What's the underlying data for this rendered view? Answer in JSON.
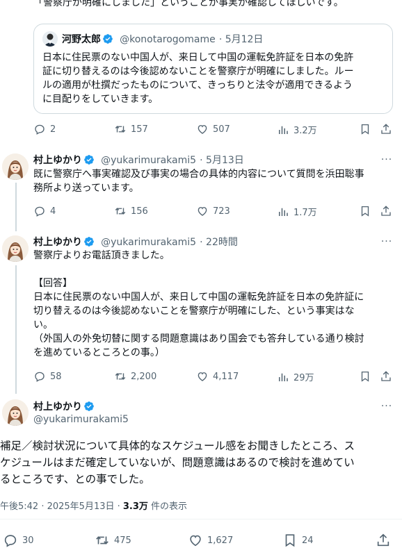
{
  "top_text": "「警察庁が明確にしました」ということが事実か確認してほしいです。",
  "quote": {
    "name": "河野太郎",
    "handle": "@konotarogomame",
    "date": "· 5月12日",
    "text": "日本に住民票のない中国人が、来日して中国の運転免許証を日本の免許\n証に切り替えるのは今後認めないことを警察庁が明確にしました。ルー\nルの適用が杜撰だったものについて、きっちりと法令が適用できるよう\nに目配りをしていきます。"
  },
  "tweet0_actions": {
    "replies": "2",
    "retweets": "157",
    "likes": "507",
    "views": "3.2万"
  },
  "tweet1": {
    "name": "村上ゆかり",
    "handle": "@yukarimurakami5",
    "date": "· 5月13日",
    "text": "既に警察庁へ事実確認及び事実の場合の具体的内容について質問を浜田聡事\n務所より送っています。",
    "replies": "4",
    "retweets": "156",
    "likes": "723",
    "views": "1.7万"
  },
  "tweet2": {
    "name": "村上ゆかり",
    "handle": "@yukarimurakami5",
    "date": "· 22時間",
    "text": "警察庁よりお電話頂きました。\n\n【回答】\n日本に住民票のない中国人が、来日して中国の運転免許証を日本の免許証に\n切り替えるのは今後認めないことを警察庁が明確にした、という事実はな\nい。\n（外国人の外免切替に関する問題意識はあり国会でも答弁している通り検討\nを進めているところとの事。）",
    "replies": "58",
    "retweets": "2,200",
    "likes": "4,117",
    "views": "29万"
  },
  "main": {
    "name": "村上ゆかり",
    "handle": "@yukarimurakami5",
    "text": "補足／検討状況について具体的なスケジュール感をお聞きしたところ、ス\nケジュールはまだ確定していないが、問題意識はあるので検討を進めてい\nるところです、との事でした。",
    "timestamp": "午後5:42 · 2025年5月13日 · ",
    "views_count": "3.3万",
    "views_suffix": " 件の表示",
    "replies": "30",
    "retweets": "475",
    "likes": "1,627",
    "bookmarks": "24"
  },
  "colors": {
    "verified": "#1d9bf0",
    "muted": "#536471",
    "border": "#cfd9de"
  }
}
